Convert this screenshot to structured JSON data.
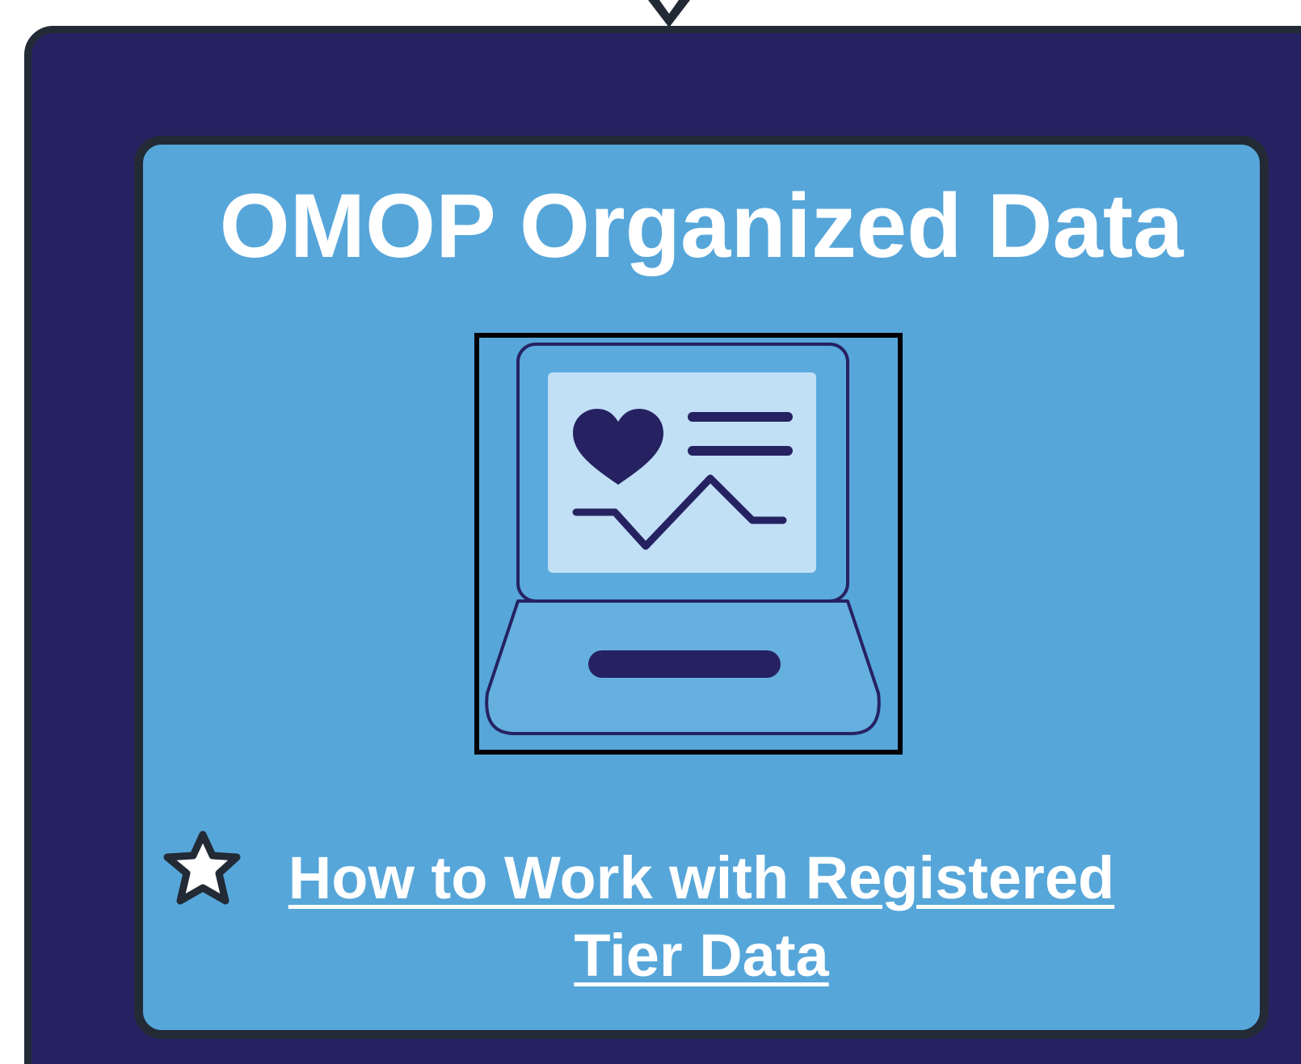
{
  "card": {
    "title": "OMOP Organized Data",
    "image_icon": "laptop-health-record-icon",
    "link": {
      "icon": "star-icon",
      "label": "How to Work with Registered Tier Data"
    }
  },
  "colors": {
    "outer_background": "#262262",
    "card_background": "#56a6da",
    "border": "#222a35",
    "text": "#ffffff",
    "icon_dark": "#262262",
    "icon_screen": "#c1e0f6"
  }
}
